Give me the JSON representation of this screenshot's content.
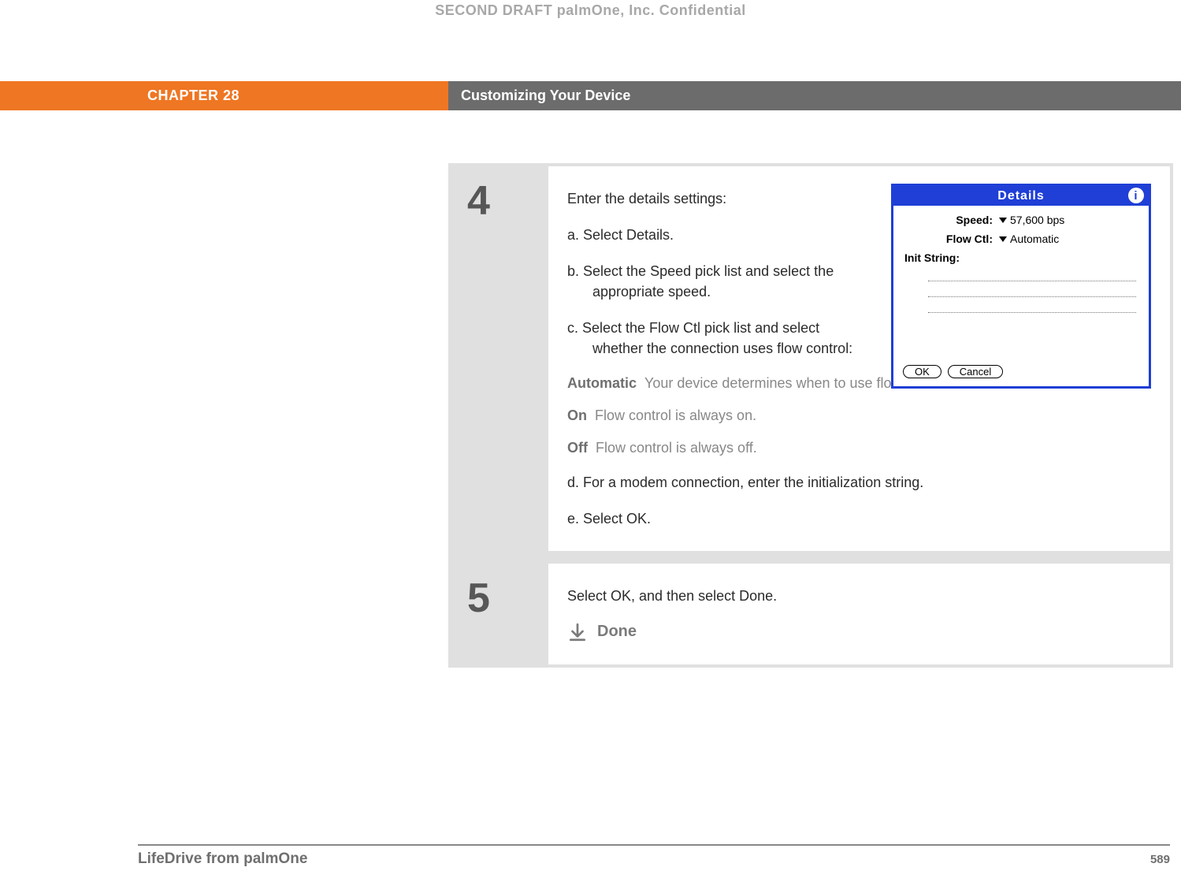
{
  "confidential": "SECOND DRAFT palmOne, Inc.  Confidential",
  "header": {
    "chapter": "CHAPTER 28",
    "title": "Customizing Your Device"
  },
  "step4": {
    "num": "4",
    "intro": "Enter the details settings:",
    "a": "a.  Select Details.",
    "b": "b.  Select the Speed pick list and select the appropriate speed.",
    "c": "c.  Select the Flow Ctl pick list and select whether the connection uses flow control:",
    "defs": {
      "auto_label": "Automatic",
      "auto_text": "Your device determines when to use flow control.",
      "on_label": "On",
      "on_text": "Flow control is always on.",
      "off_label": "Off",
      "off_text": "Flow control is always off."
    },
    "d": "d.  For a modem connection, enter the initialization string.",
    "e": "e.  Select OK."
  },
  "step5": {
    "num": "5",
    "text": "Select OK, and then select Done.",
    "done": "Done"
  },
  "palm": {
    "title": "Details",
    "info": "i",
    "speed_label": "Speed:",
    "speed_value": "57,600 bps",
    "flow_label": "Flow Ctl:",
    "flow_value": "Automatic",
    "init_label": "Init String:",
    "ok": "OK",
    "cancel": "Cancel"
  },
  "footer": {
    "left": "LifeDrive from palmOne",
    "page": "589"
  }
}
